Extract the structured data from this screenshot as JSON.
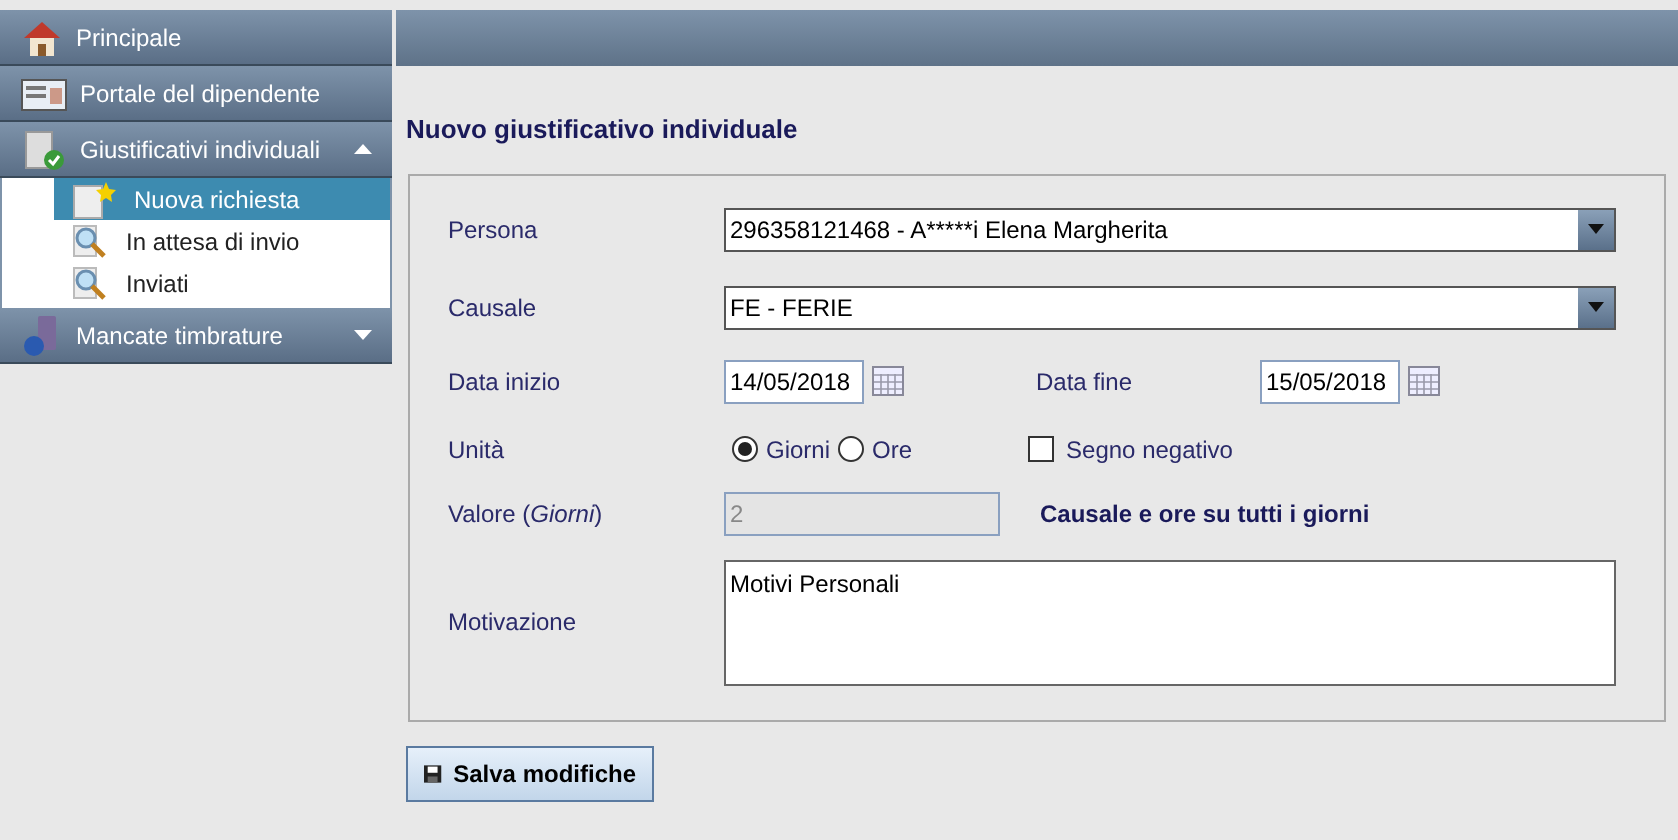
{
  "sidebar": {
    "sections": [
      {
        "label": "Principale"
      },
      {
        "label": "Portale del dipendente"
      },
      {
        "label": "Giustificativi individuali",
        "expanded": true,
        "children": [
          {
            "label": "Nuova richiesta",
            "selected": true
          },
          {
            "label": "In attesa di invio",
            "selected": false
          },
          {
            "label": "Inviati",
            "selected": false
          }
        ]
      },
      {
        "label": "Mancate timbrature",
        "expanded": false
      }
    ]
  },
  "page_title": "Nuovo giustificativo individuale",
  "form": {
    "persona": {
      "label": "Persona",
      "value": "296358121468 - A*****i Elena Margherita"
    },
    "causale": {
      "label": "Causale",
      "value": "FE - FERIE"
    },
    "data_inizio": {
      "label": "Data inizio",
      "value": "14/05/2018"
    },
    "data_fine": {
      "label": "Data fine",
      "value": "15/05/2018"
    },
    "unita": {
      "label": "Unità",
      "options": [
        {
          "label": "Giorni",
          "selected": true
        },
        {
          "label": "Ore",
          "selected": false
        }
      ]
    },
    "segno_negativo": {
      "label": "Segno negativo",
      "checked": false
    },
    "valore": {
      "label": "Valore (*Giorni*)",
      "value": "2",
      "disabled": true
    },
    "note": "Causale e ore su tutti i giorni",
    "motivazione": {
      "label": "Motivazione",
      "value": "Motivi Personali"
    }
  },
  "save_button": "Salva modifiche"
}
